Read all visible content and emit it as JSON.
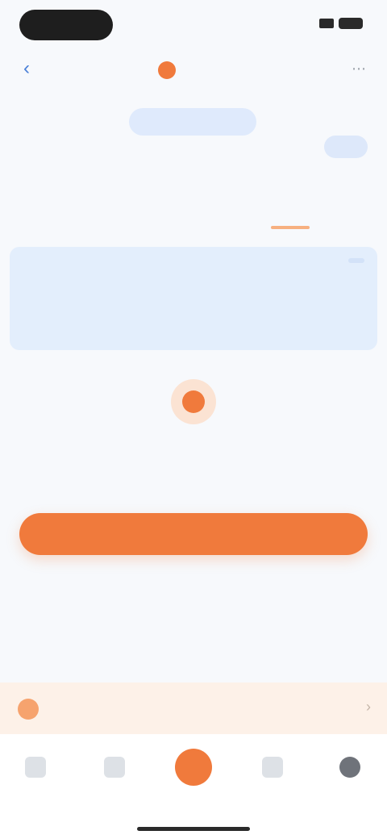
{
  "status_bar": {},
  "nav": {
    "brand": "",
    "back_icon": "chevron-left-icon",
    "more_icon": "more-icon"
  },
  "segmented": {
    "label": ""
  },
  "account": {
    "label": "",
    "sub": "",
    "action": ""
  },
  "tabs": [
    {
      "label": ""
    },
    {
      "label": ""
    }
  ],
  "info_card": {
    "title": "",
    "tag": "",
    "desc": "",
    "link": ""
  },
  "empty_state": {
    "message": "",
    "hint": ""
  },
  "primary_button": {
    "label": ""
  },
  "promo": {
    "title": "",
    "sub": ""
  },
  "tab_bar": {
    "items": [
      {
        "label": ""
      },
      {
        "label": ""
      },
      {
        "label": ""
      },
      {
        "label": ""
      },
      {
        "label": ""
      }
    ]
  },
  "colors": {
    "accent": "#f07a3c",
    "primary_blue": "#3f7ad6",
    "card_bg": "#e3eefc",
    "promo_bg": "#fdf1e8"
  }
}
